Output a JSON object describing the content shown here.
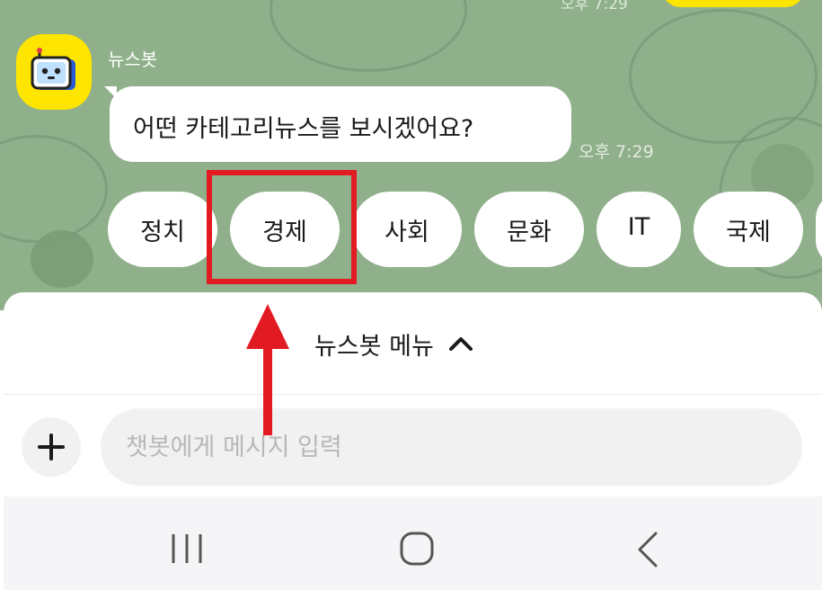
{
  "colors": {
    "chat_background": "#8fb08a",
    "bubble": "#ffffff",
    "bot_avatar": "#fee500",
    "annotation": "#e21b23",
    "input_background": "#f1f1f1",
    "nav_background": "#f5f5f7"
  },
  "previous_message": {
    "time": "오후 7:29"
  },
  "bot": {
    "name": "뉴스봇",
    "avatar_icon": "robot-icon"
  },
  "message": {
    "text": "어떤 카테고리뉴스를 보시겠어요?",
    "time": "오후 7:29"
  },
  "quick_replies": [
    "정치",
    "경제",
    "사회",
    "문화",
    "IT",
    "국제"
  ],
  "annotation": {
    "highlighted_reply": "경제",
    "arrow_icon": "up-arrow-icon"
  },
  "menu": {
    "label": "뉴스봇 메뉴",
    "toggle_icon": "chevron-up-icon"
  },
  "input": {
    "add_icon": "plus-icon",
    "placeholder": "챗봇에게 메시지 입력",
    "value": ""
  },
  "nav": {
    "recent_icon": "recent-apps-icon",
    "home_icon": "home-icon",
    "back_icon": "back-icon"
  }
}
